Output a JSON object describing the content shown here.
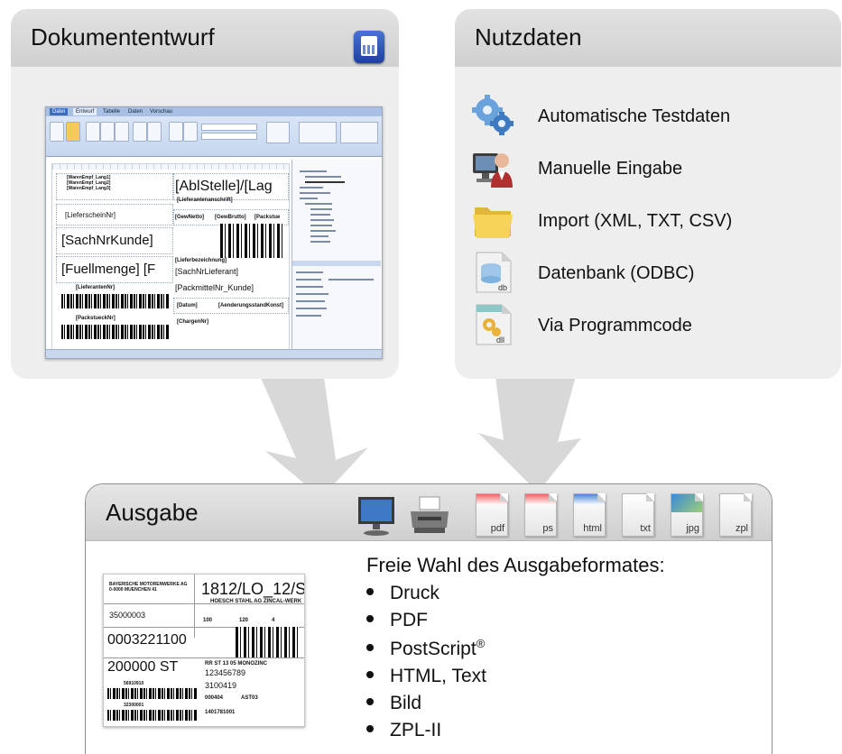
{
  "panels": {
    "doc": {
      "title": "Dokumententwurf",
      "icon": "calculator-icon"
    },
    "data": {
      "title": "Nutzdaten",
      "items": [
        {
          "label": "Automatische Testdaten",
          "icon": "gears-icon"
        },
        {
          "label": "Manuelle Eingabe",
          "icon": "user-computer-icon"
        },
        {
          "label": "Import (XML, TXT, CSV)",
          "icon": "folder-icon"
        },
        {
          "label": "Datenbank (ODBC)",
          "icon": "database-file-icon",
          "badge": "db"
        },
        {
          "label": "Via Programmcode",
          "icon": "dll-file-icon",
          "badge": "dll"
        }
      ]
    },
    "output": {
      "title": "Ausgabe",
      "heading": "Freie Wahl des Ausgabeformates:",
      "bullets": [
        "Druck",
        "PDF",
        "PostScript",
        "HTML, Text",
        "Bild",
        "ZPL-II"
      ],
      "postscript_sup": "®",
      "format_icons": [
        {
          "name": "monitor-icon"
        },
        {
          "name": "printer-icon"
        },
        {
          "name": "pdf-file-icon",
          "ext": "pdf",
          "color": "#d83a3a"
        },
        {
          "name": "ps-file-icon",
          "ext": "ps",
          "color": "#d83a3a"
        },
        {
          "name": "html-file-icon",
          "ext": "html",
          "color": "#2a6fd0"
        },
        {
          "name": "txt-file-icon",
          "ext": "txt",
          "color": "#dddddd"
        },
        {
          "name": "jpg-file-icon",
          "ext": "jpg",
          "color": "#3a8ad8"
        },
        {
          "name": "zpl-file-icon",
          "ext": "zpl",
          "color": "#cccccc"
        }
      ]
    }
  },
  "designer": {
    "fields": {
      "waren_empf": "[WarenEmpf_Lang1]\n[WarenEmpf_Lang2]\n[WarenEmpf_Lang3]",
      "abl_stelle": "[AblStelle]/[Lag",
      "lieferant_anschrift": "[Lieferantenanschrift]",
      "lieferschein": "[LieferscheinNr]",
      "gew_netto": "[GewNetto]",
      "gew_brutto": "[GewBrutto]",
      "packstue": "[Packstue",
      "sachnr_kunde": "[SachNrKunde]",
      "lieferbezeichnung": "[Lieferbezeichnung]",
      "fuellmenge": "[Fuellmenge] [F",
      "sachnr_lieferant": "[SachNrLieferant]",
      "packmittel": "[PackmittelNr_Kunde]",
      "lieferanten_nr": "[LieferantenNr]",
      "datum": "[Datum]",
      "aenderung": "[AenderungsstandKonst]",
      "packstueck_nr": "[PackstueckNr]",
      "chargen_nr": "[ChargenNr]"
    },
    "tabs": [
      "Datei",
      "Entwurf",
      "Tabelle",
      "Daten",
      "Vorschau"
    ]
  },
  "label_preview": {
    "sender": "BAYERISCHE MOTORENWERKE AG\n0-0000 MUENCHEN 41",
    "code": "1812/LO_12/S",
    "company": "HOESCH STAHL AG ZINCAL-WERK",
    "num1": "35000003",
    "w1": "100",
    "w2": "120",
    "w3": "4",
    "big_num": "0003221100",
    "qty": "200000 ST",
    "desc": "RR ST 13 05 MONOZINC",
    "n2": "123456789",
    "n3": "3100419",
    "bc1": "56910910",
    "d1": "000404",
    "d2": "AST03",
    "bc2": "32300001",
    "n4": "1401781001"
  }
}
